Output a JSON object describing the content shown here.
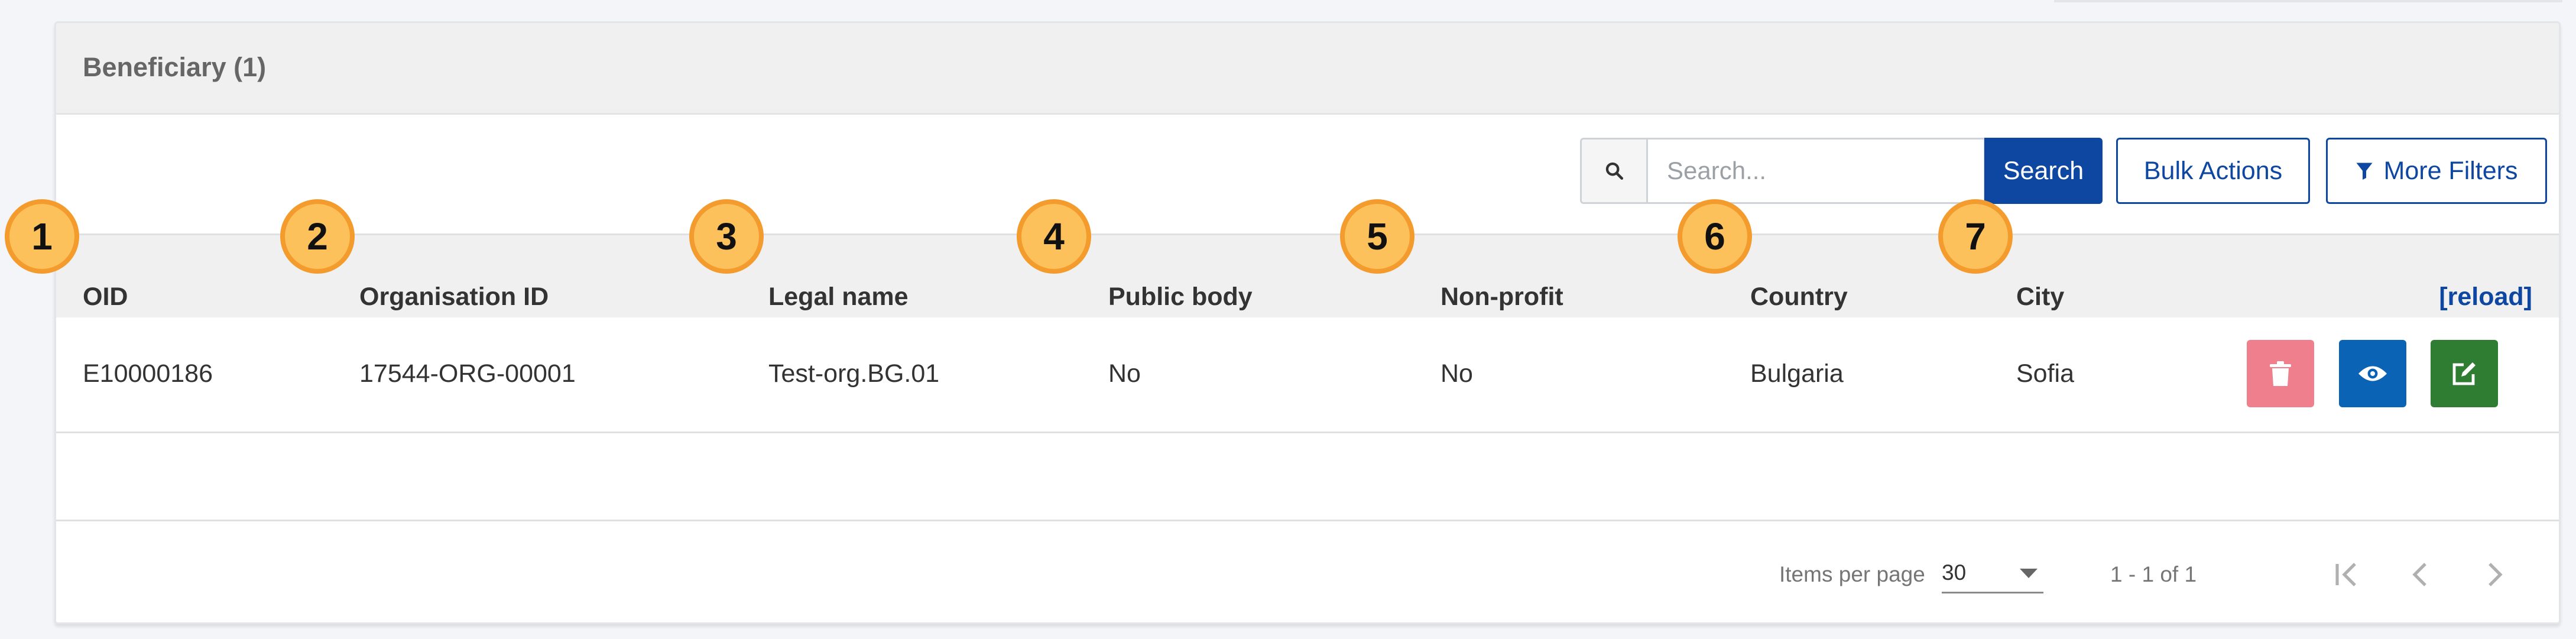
{
  "card": {
    "title": "Beneficiary (1)"
  },
  "toolbar": {
    "search_placeholder": "Search...",
    "search_label": "Search",
    "bulk_label": "Bulk Actions",
    "filters_label": "More Filters"
  },
  "table": {
    "columns": [
      "OID",
      "Organisation ID",
      "Legal name",
      "Public body",
      "Non-profit",
      "Country",
      "City"
    ],
    "reload_label": "[reload]",
    "rows": [
      {
        "oid": "E10000186",
        "org_id": "17544-ORG-00001",
        "legal_name": "Test-org.BG.01",
        "public_body": "No",
        "non_profit": "No",
        "country": "Bulgaria",
        "city": "Sofia"
      }
    ]
  },
  "paginator": {
    "items_per_page_label": "Items per page",
    "items_per_page": "30",
    "range": "1 - 1 of 1"
  },
  "callouts": [
    "1",
    "2",
    "3",
    "4",
    "5",
    "6",
    "7"
  ],
  "colors": {
    "primary": "#0e47a1",
    "delete": "#ef7f8d",
    "view": "#0b63b5",
    "edit": "#2e7d32",
    "callout_fill": "#fcc15a",
    "callout_border": "#f39b2d"
  },
  "icons": {
    "search": "search-icon",
    "filter": "filter-icon",
    "delete": "trash-icon",
    "view": "eye-icon",
    "edit": "edit-icon",
    "dropdown": "caret-down-icon",
    "first": "first-page-icon",
    "prev": "chevron-left-icon",
    "next": "chevron-right-icon",
    "last": "last-page-icon"
  }
}
